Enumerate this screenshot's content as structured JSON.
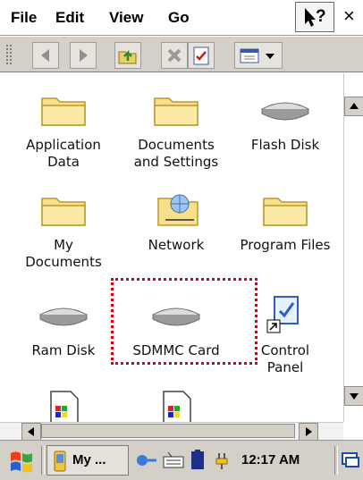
{
  "menu": {
    "file": "File",
    "edit": "Edit",
    "view": "View",
    "go": "Go",
    "help": "?",
    "close": "×"
  },
  "toolbar": {
    "icons": [
      "back-icon",
      "forward-icon",
      "up-folder-icon",
      "delete-icon",
      "properties-icon",
      "view-icon"
    ]
  },
  "items": [
    {
      "label": "Application\nData",
      "icon": "folder-icon"
    },
    {
      "label": "Documents\nand Settings",
      "icon": "folder-icon"
    },
    {
      "label": "Flash Disk",
      "icon": "disk-icon"
    },
    {
      "label": "My\nDocuments",
      "icon": "folder-icon"
    },
    {
      "label": "Network",
      "icon": "network-folder-icon"
    },
    {
      "label": "Program Files",
      "icon": "folder-icon"
    },
    {
      "label": "Ram Disk",
      "icon": "disk-icon"
    },
    {
      "label": "SDMMC Card",
      "icon": "disk-icon"
    },
    {
      "label": "Control\nPanel",
      "icon": "control-panel-icon"
    },
    {
      "label": "",
      "icon": "document-icon"
    },
    {
      "label": "",
      "icon": "document-icon"
    }
  ],
  "taskbar": {
    "window_label": "My ...",
    "clock": "12:17 AM"
  },
  "colors": {
    "highlight": "#d6001c",
    "folder": "#f7e089",
    "chrome": "#d4d0c8"
  }
}
